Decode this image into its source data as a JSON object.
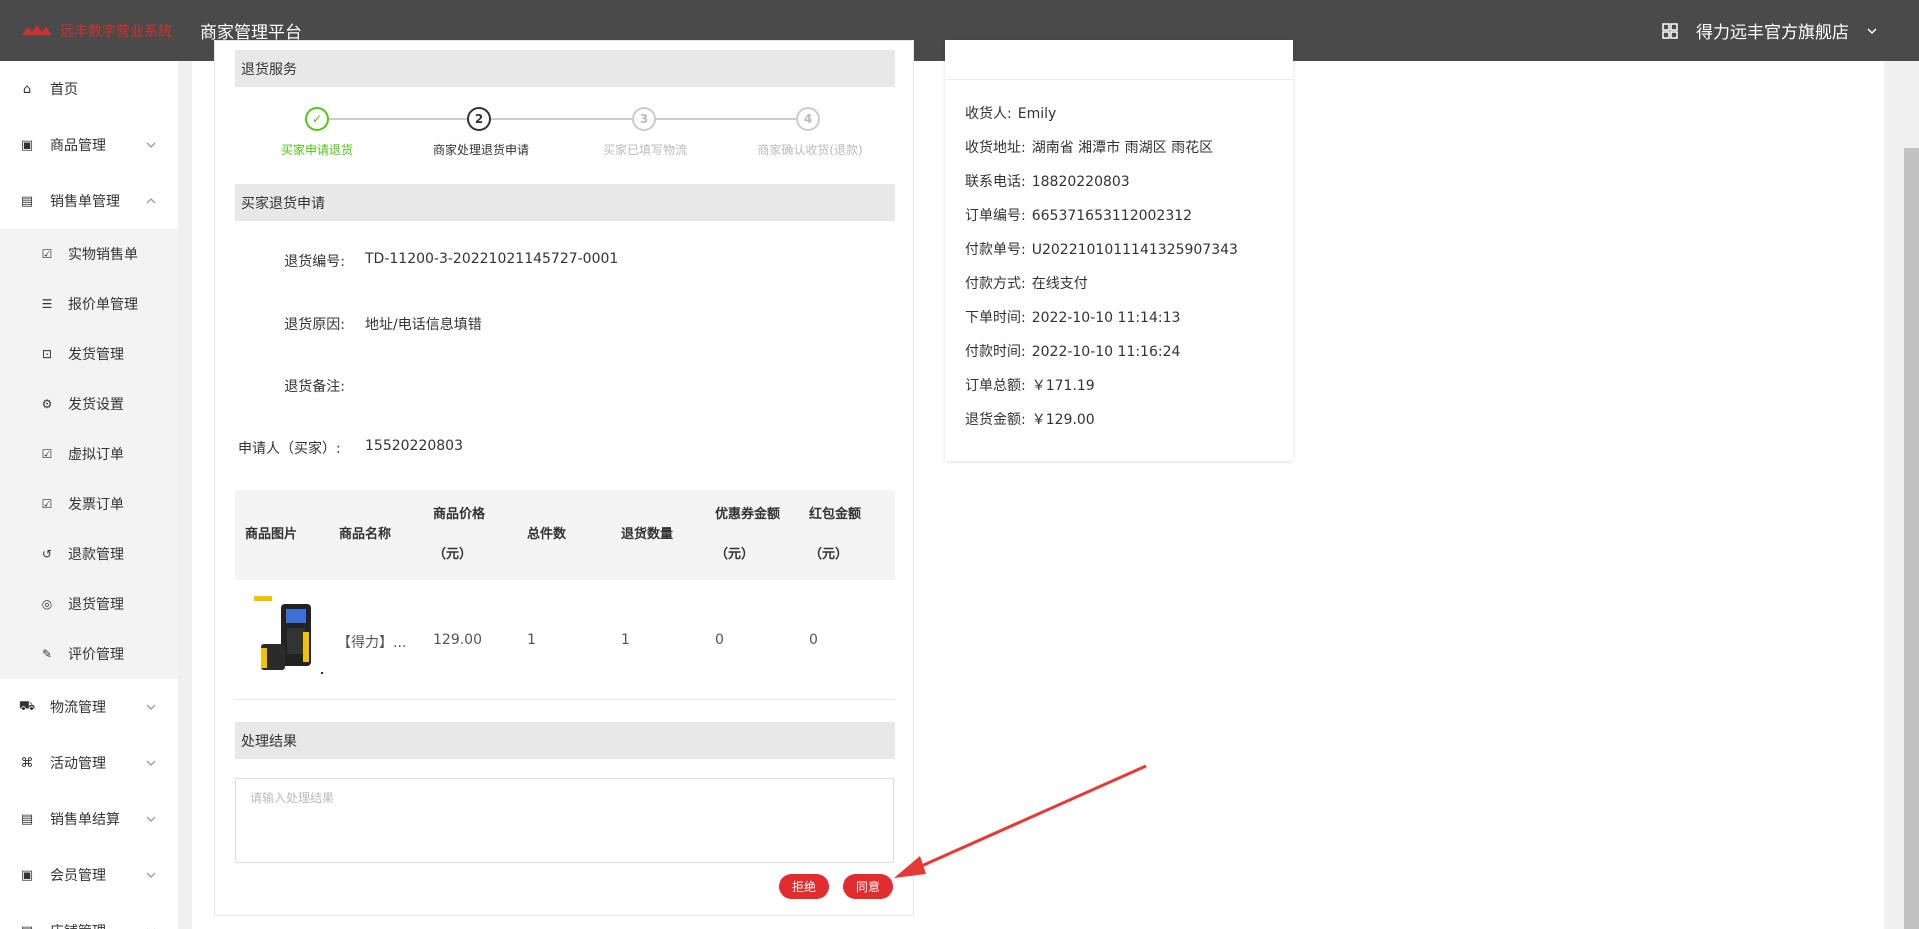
{
  "brand": {
    "logo_text": "远丰数字营业系统",
    "platform_title": "商家管理平台",
    "store_name": "得力远丰官方旗舰店"
  },
  "sidebar": {
    "items": [
      {
        "label": "首页",
        "icon": "home-icon"
      },
      {
        "label": "商品管理",
        "icon": "goods-icon"
      },
      {
        "label": "销售单管理",
        "icon": "sales-icon"
      }
    ],
    "sub_items": [
      {
        "label": "实物销售单",
        "icon": "doc-icon"
      },
      {
        "label": "报价单管理",
        "icon": "list-icon"
      },
      {
        "label": "发货管理",
        "icon": "box-icon"
      },
      {
        "label": "发货设置",
        "icon": "gear-icon"
      },
      {
        "label": "虚拟订单",
        "icon": "virtual-icon"
      },
      {
        "label": "发票订单",
        "icon": "invoice-icon"
      },
      {
        "label": "退款管理",
        "icon": "refund-icon"
      },
      {
        "label": "退货管理",
        "icon": "return-icon"
      },
      {
        "label": "评价管理",
        "icon": "edit-icon"
      }
    ],
    "bottom_items": [
      {
        "label": "物流管理",
        "icon": "truck-icon"
      },
      {
        "label": "活动管理",
        "icon": "tag-icon"
      },
      {
        "label": "销售单结算",
        "icon": "settle-icon"
      },
      {
        "label": "会员管理",
        "icon": "member-icon"
      },
      {
        "label": "店铺管理",
        "icon": "shop-icon"
      }
    ]
  },
  "return_service": {
    "section_title": "退货服务",
    "steps": [
      {
        "num": "✓",
        "label": "买家申请退货",
        "state": "done"
      },
      {
        "num": "2",
        "label": "商家处理退货申请",
        "state": "active"
      },
      {
        "num": "3",
        "label": "买家已填写物流",
        "state": "pending"
      },
      {
        "num": "4",
        "label": "商家确认收货(退款)",
        "state": "pending"
      }
    ]
  },
  "application": {
    "section_title": "买家退货申请",
    "return_no_label": "退货编号:",
    "return_no": "TD-11200-3-20221021145727-0001",
    "reason_label": "退货原因:",
    "reason": "地址/电话信息填错",
    "remark_label": "退货备注:",
    "remark": "",
    "applicant_label": "申请人（买家）:",
    "applicant": "15520220803"
  },
  "table": {
    "headers": [
      {
        "line1": "商品图片",
        "line2": ""
      },
      {
        "line1": "商品名称",
        "line2": ""
      },
      {
        "line1": "商品价格",
        "line2": "（元）"
      },
      {
        "line1": "总件数",
        "line2": ""
      },
      {
        "line1": "退货数量",
        "line2": ""
      },
      {
        "line1": "优惠券金额",
        "line2": "（元）"
      },
      {
        "line1": "红包金额",
        "line2": "（元）"
      }
    ],
    "row": {
      "name": "【得力】...",
      "price": "129.00",
      "total": "1",
      "qty": "1",
      "coupon": "0",
      "redpack": "0"
    }
  },
  "result": {
    "section_title": "处理结果",
    "placeholder": "请输入处理结果",
    "reject_label": "拒绝",
    "agree_label": "同意"
  },
  "order_info": {
    "rows": [
      {
        "k": "收货人:",
        "v": "Emily"
      },
      {
        "k": "收货地址:",
        "v": "湖南省 湘潭市 雨湖区 雨花区"
      },
      {
        "k": "联系电话:",
        "v": "18820220803"
      },
      {
        "k": "订单编号:",
        "v": "665371653112002312"
      },
      {
        "k": "付款单号:",
        "v": "U2022101011141325907343"
      },
      {
        "k": "付款方式:",
        "v": "在线支付"
      },
      {
        "k": "下单时间:",
        "v": "2022-10-10 11:14:13"
      },
      {
        "k": "付款时间:",
        "v": "2022-10-10 11:16:24"
      },
      {
        "k": "订单总额:",
        "v": "￥171.19"
      },
      {
        "k": "退货金额:",
        "v": "￥129.00"
      }
    ]
  },
  "colors": {
    "topbar": "#4a4a4a",
    "accent_red": "#e12d2d",
    "step_done": "#52c41a"
  }
}
